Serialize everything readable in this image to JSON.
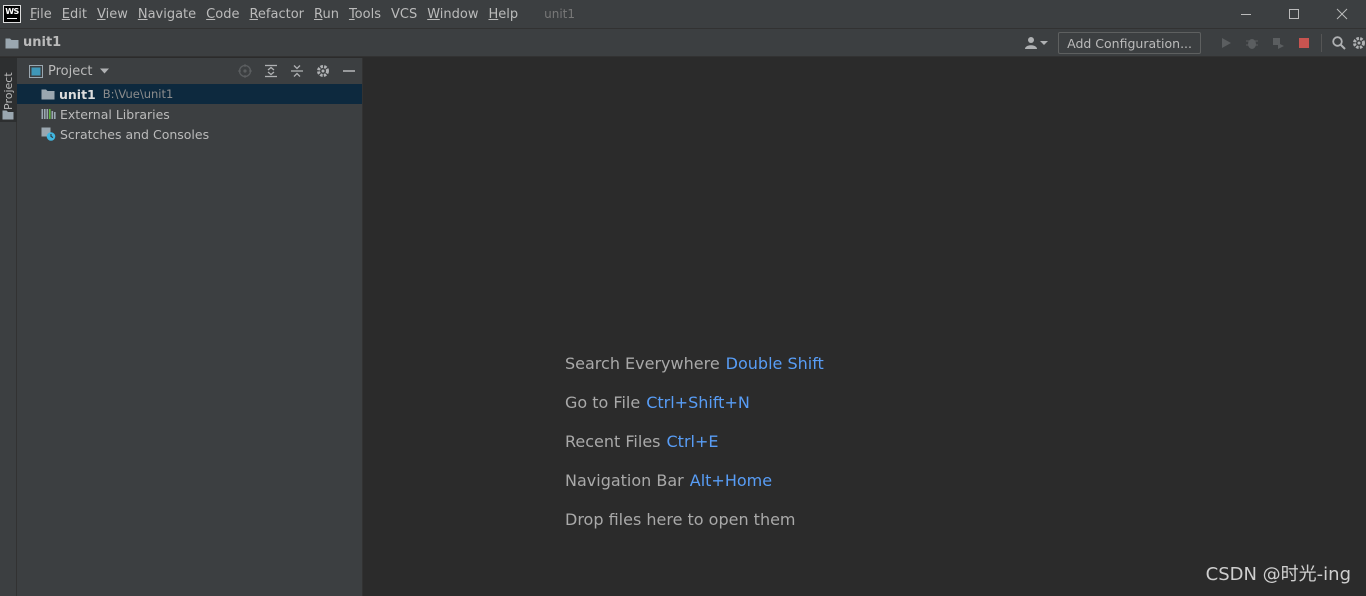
{
  "app": {
    "logo_text": "WS",
    "window_title": "unit1"
  },
  "menu": [
    {
      "mnemonic": "F",
      "rest": "ile"
    },
    {
      "mnemonic": "E",
      "rest": "dit"
    },
    {
      "mnemonic": "V",
      "rest": "iew"
    },
    {
      "mnemonic": "N",
      "rest": "avigate"
    },
    {
      "mnemonic": "C",
      "rest": "ode"
    },
    {
      "mnemonic": "R",
      "rest": "efactor"
    },
    {
      "mnemonic": "R",
      "rest": "un"
    },
    {
      "mnemonic": "T",
      "rest": "ools"
    },
    {
      "mnemonic": "",
      "rest": "VCS"
    },
    {
      "mnemonic": "W",
      "rest": "indow"
    },
    {
      "mnemonic": "H",
      "rest": "elp"
    }
  ],
  "navbar": {
    "breadcrumb": "unit1",
    "add_configuration": "Add Configuration..."
  },
  "tool_stripe": {
    "project_label": "Project"
  },
  "project_panel": {
    "title": "Project",
    "tree": [
      {
        "label": "unit1",
        "path": "B:\\Vue\\unit1",
        "icon": "folder-icon",
        "selected": true
      },
      {
        "label": "External Libraries",
        "path": "",
        "icon": "library-icon",
        "selected": false
      },
      {
        "label": "Scratches and Consoles",
        "path": "",
        "icon": "scratches-icon",
        "selected": false
      }
    ]
  },
  "editor": {
    "hints": [
      {
        "text": "Search Everywhere",
        "key": "Double Shift"
      },
      {
        "text": "Go to File",
        "key": "Ctrl+Shift+N"
      },
      {
        "text": "Recent Files",
        "key": "Ctrl+E"
      },
      {
        "text": "Navigation Bar",
        "key": "Alt+Home"
      },
      {
        "text": "Drop files here to open them",
        "key": ""
      }
    ]
  },
  "watermark": "CSDN @时光-ing",
  "colors": {
    "background": "#2b2b2b",
    "panel": "#3c3f41",
    "selection": "#0d293e",
    "shortcut": "#589df6",
    "stop_red": "#c75450"
  }
}
